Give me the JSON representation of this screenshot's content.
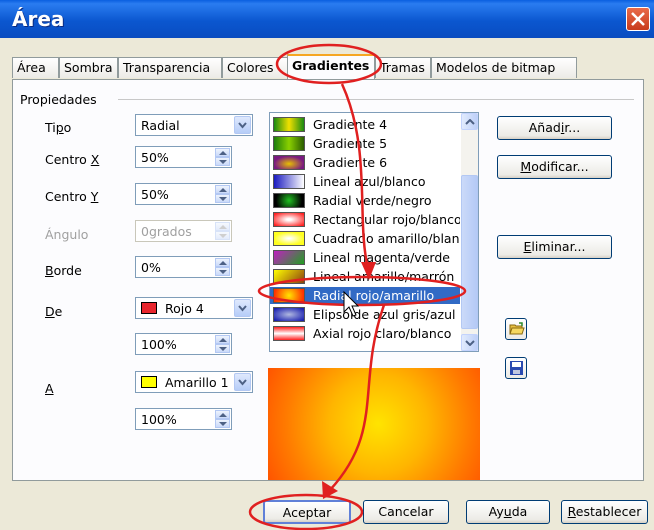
{
  "window": {
    "title": "Área"
  },
  "tabs": [
    "Área",
    "Sombra",
    "Transparencia",
    "Colores",
    "Gradientes",
    "Tramas",
    "Modelos de bitmap"
  ],
  "active_tab": "Gradientes",
  "properties": {
    "group_label": "Propiedades",
    "tipo": {
      "pre": "Ti",
      "acc": "p",
      "post": "o",
      "value": "Radial"
    },
    "centro_x": {
      "pre": "Centro ",
      "acc": "X",
      "post": "",
      "value": "50%"
    },
    "centro_y": {
      "pre": "Centro ",
      "acc": "Y",
      "post": "",
      "value": "50%"
    },
    "angulo": {
      "label": "Ángulo",
      "value": "0grados"
    },
    "borde": {
      "pre": "",
      "acc": "B",
      "post": "orde",
      "value": "0%"
    },
    "de": {
      "pre": "",
      "acc": "D",
      "post": "e",
      "color_name": "Rojo 4",
      "color": "#e8262e",
      "intensity": "100%"
    },
    "a": {
      "pre": "",
      "acc": "A",
      "post": "",
      "color_name": "Amarillo 1",
      "color": "#ffff00",
      "intensity": "100%"
    }
  },
  "gradient_list": {
    "items": [
      {
        "label": "Gradiente 4",
        "thumb": "linear-gradient(90deg,#1a8a10,#f0e000,#1a8a10)"
      },
      {
        "label": "Gradiente 5",
        "thumb": "linear-gradient(90deg,#1c7d0c,#8ad000,#2a5d00)"
      },
      {
        "label": "Gradiente 6",
        "thumb": "radial-gradient(ellipse at 50% 60%,#e8c000,#7a1a80 70%)"
      },
      {
        "label": "Lineal azul/blanco",
        "thumb": "linear-gradient(90deg,#1a1ac0,#ffffff)"
      },
      {
        "label": "Radial verde/negro",
        "thumb": "radial-gradient(circle,#20c020,#000000 80%)"
      },
      {
        "label": "Rectangular rojo/blanco",
        "thumb": "radial-gradient(ellipse,#ffffff 10%,#ff2020 90%)"
      },
      {
        "label": "Cuadrado amarillo/blanco",
        "thumb": "radial-gradient(ellipse,#ffffff 5%,#ffff20 70%)"
      },
      {
        "label": "Lineal magenta/verde",
        "thumb": "linear-gradient(135deg,#c020c0,#20a020)"
      },
      {
        "label": "Lineal amarillo/marrón",
        "thumb": "linear-gradient(135deg,#ffff00,#8a4010)"
      },
      {
        "label": "Radial rojo/amarillo",
        "thumb": "radial-gradient(circle,#ffe400,#ff3000 90%)"
      },
      {
        "label": "Elipsoide azul gris/azul",
        "thumb": "radial-gradient(ellipse,#b0b8e0,#1a20b0 90%)"
      },
      {
        "label": "Axial rojo claro/blanco",
        "thumb": "linear-gradient(180deg,#ff2020,#ffffff 50%,#ff2020)"
      }
    ],
    "selected_index": 9
  },
  "side_buttons": {
    "add": {
      "pre": "Añad",
      "acc": "i",
      "post": "r..."
    },
    "modify": {
      "pre": "",
      "acc": "M",
      "post": "odificar..."
    },
    "delete": {
      "pre": "",
      "acc": "E",
      "post": "liminar..."
    }
  },
  "footer": {
    "ok": "Aceptar",
    "cancel": "Cancelar",
    "help": {
      "pre": "Ay",
      "acc": "u",
      "post": "da"
    },
    "reset": {
      "pre": "",
      "acc": "R",
      "post": "establecer"
    }
  },
  "colors": {
    "titlebar": "#0b57d0",
    "selection": "#316ac5",
    "annotation": "#e02020"
  }
}
